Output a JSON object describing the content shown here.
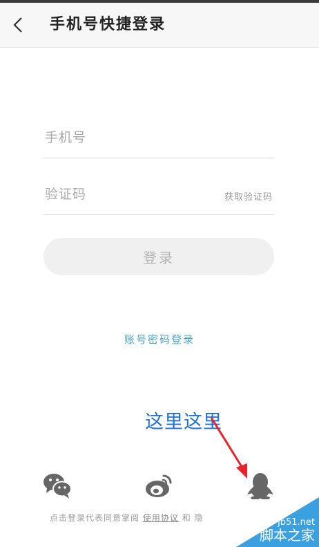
{
  "header": {
    "title": "手机号快捷登录"
  },
  "form": {
    "phone_placeholder": "手机号",
    "code_placeholder": "验证码",
    "get_code_label": "获取验证码",
    "login_label": "登录"
  },
  "password_login_label": "账号密码登录",
  "annotation": "这里这里",
  "social_icons": [
    "wechat-icon",
    "weibo-icon",
    "qq-icon"
  ],
  "terms": {
    "prefix": "点击登录代表同意掌阅",
    "link": "使用协议",
    "suffix": "和 隐"
  },
  "watermark": {
    "site": "jb51.net",
    "name": "脚本之家"
  },
  "colors": {
    "accent": "#4aa3c7",
    "annotation": "#1f6fd6",
    "arrow": "#e8232a"
  }
}
